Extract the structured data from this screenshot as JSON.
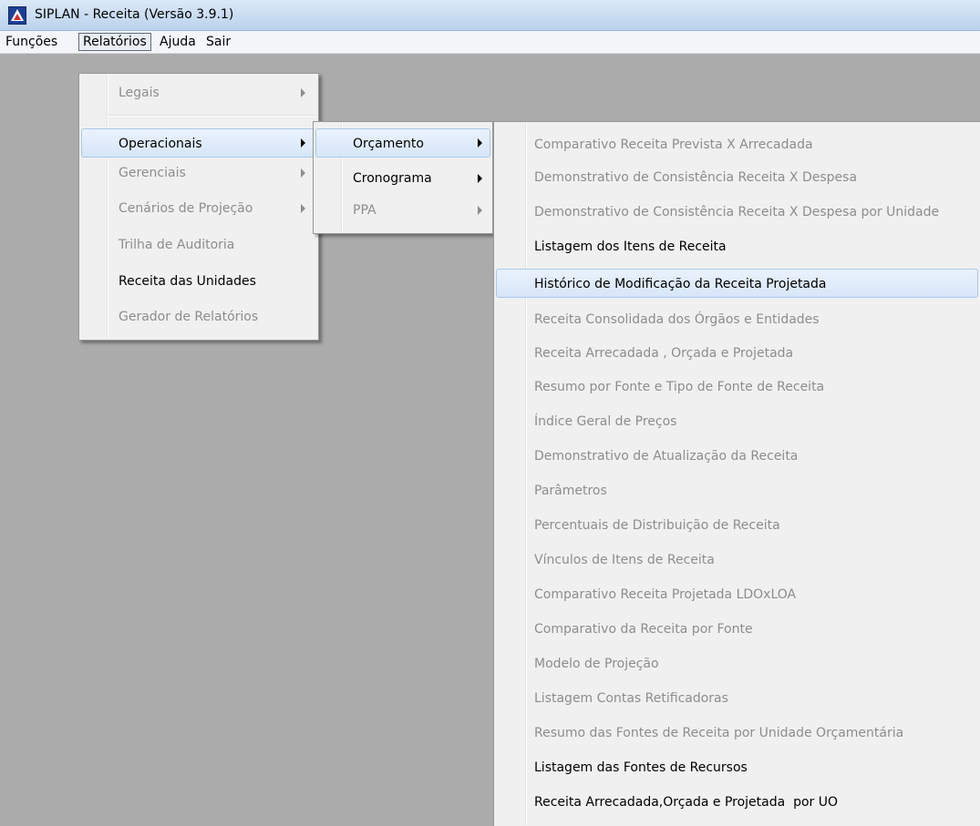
{
  "window": {
    "title": "SIPLAN - Receita (Versão 3.9.1)"
  },
  "menubar": {
    "items": [
      {
        "label": "Funções"
      },
      {
        "label": "Relatórios"
      },
      {
        "label": "Ajuda"
      },
      {
        "label": "Sair"
      }
    ]
  },
  "relatorios_menu": {
    "items": [
      {
        "label": "Legais"
      },
      {
        "label": "Operacionais"
      },
      {
        "label": "Gerenciais"
      },
      {
        "label": "Cenários de Projeção"
      },
      {
        "label": "Trilha de Auditoria"
      },
      {
        "label": "Receita das Unidades"
      },
      {
        "label": "Gerador de Relatórios"
      }
    ]
  },
  "operacionais_menu": {
    "items": [
      {
        "label": "Orçamento"
      },
      {
        "label": "Cronograma"
      },
      {
        "label": "PPA"
      }
    ]
  },
  "orcamento_menu": {
    "items": [
      {
        "label": "Comparativo Receita Prevista X Arrecadada"
      },
      {
        "label": "Demonstrativo de Consistência Receita X Despesa"
      },
      {
        "label": "Demonstrativo de Consistência Receita X Despesa por Unidade"
      },
      {
        "label": "Listagem dos Itens de Receita"
      },
      {
        "label": "Histórico de Modificação da Receita Projetada"
      },
      {
        "label": "Receita Consolidada dos Órgãos e Entidades"
      },
      {
        "label": "Receita Arrecadada , Orçada e Projetada"
      },
      {
        "label": "Resumo por Fonte e Tipo de Fonte de Receita"
      },
      {
        "label": "Índice Geral de Preços"
      },
      {
        "label": "Demonstrativo de Atualização da Receita"
      },
      {
        "label": "Parâmetros"
      },
      {
        "label": "Percentuais de Distribuição de Receita"
      },
      {
        "label": "Vínculos de Itens de Receita"
      },
      {
        "label": "Comparativo Receita Projetada LDOxLOA"
      },
      {
        "label": "Comparativo da Receita por Fonte"
      },
      {
        "label": "Modelo de Projeção"
      },
      {
        "label": "Listagem Contas Retificadoras"
      },
      {
        "label": "Resumo das Fontes de Receita por Unidade Orçamentária"
      },
      {
        "label": "Listagem das Fontes de Recursos"
      },
      {
        "label": "Receita Arrecadada,Orçada e Projetada  por UO"
      }
    ]
  }
}
